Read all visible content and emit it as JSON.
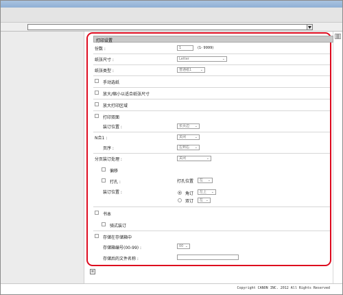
{
  "addressbar": {
    "value": ""
  },
  "panel": {
    "title": "打印设置",
    "copies_label": "份数 :",
    "copies_value": "1",
    "copies_range": "(1- 9999)",
    "paper_size_label": "纸张尺寸 :",
    "paper_size_value": "Letter",
    "paper_type_label": "纸张类型 :",
    "paper_type_value": "普通纸1",
    "manual_feed_label": "手动选纸",
    "zoom_fit_label": "放大/缩小以适合纸张尺寸",
    "enlarge_print_area_label": "放大打印区域",
    "duplex_label": "打印双面",
    "binding_position_label": "装订位置 :",
    "binding_position_value": "长页边",
    "nup_label": "N合1 :",
    "nup_value": "关闭",
    "page_order_label": "页序 :",
    "page_order_value": "左到右",
    "finishing_label": "分页装订处理 :",
    "finishing_value": "关闭",
    "offset_label": "偏移",
    "punch_label": "打孔 :",
    "punch_position_label": "打孔位置",
    "punch_position_value": "左",
    "staple_position_label": "装订位置 :",
    "staple_corner_label": "角订",
    "staple_corner_value": "左上",
    "staple_double_label": "双订",
    "staple_double_value": "左",
    "booklet_label": "书本",
    "saddle_stitch_label": "骑式装订",
    "store_in_box_label": "存储在存储箱中",
    "box_number_label": "存储箱编号(00-99) :",
    "box_number_value": "00",
    "stored_file_name_label": "存储后的文件名称 :",
    "stored_file_name_value": ""
  },
  "footer": {
    "copyright": "Copyright CANON INC. 2012 All Rights Reserved"
  },
  "colors": {
    "highlight_border": "#dd0a1e",
    "titlebar": "#8fb0d6"
  },
  "icons": {
    "addr_dropdown": "chevron-down-icon",
    "scroll_up": "scroll-up-icon",
    "collapse": "collapse-icon"
  }
}
